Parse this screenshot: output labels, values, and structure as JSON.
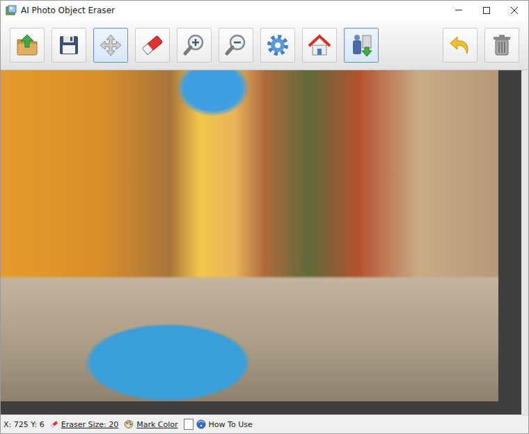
{
  "window": {
    "title": "AI Photo Object Eraser"
  },
  "toolbar": {
    "main": [
      {
        "kind": "open",
        "selected": false
      },
      {
        "kind": "save",
        "selected": false
      },
      {
        "kind": "move",
        "selected": true
      },
      {
        "kind": "eraser",
        "selected": false
      },
      {
        "kind": "zoomin",
        "selected": false
      },
      {
        "kind": "zoomout",
        "selected": false
      },
      {
        "kind": "settings",
        "selected": false
      },
      {
        "kind": "home",
        "selected": false
      },
      {
        "kind": "remove",
        "selected": true
      }
    ],
    "edit": [
      {
        "kind": "undo",
        "selected": false
      },
      {
        "kind": "delete",
        "selected": false
      }
    ]
  },
  "status_bar": {
    "coords": "X: 725 Y: 6",
    "eraser_size": "Eraser Size: 20",
    "mark_color": "Mark Color",
    "mark_swatch": "#ffffff",
    "help": "How To Use"
  }
}
